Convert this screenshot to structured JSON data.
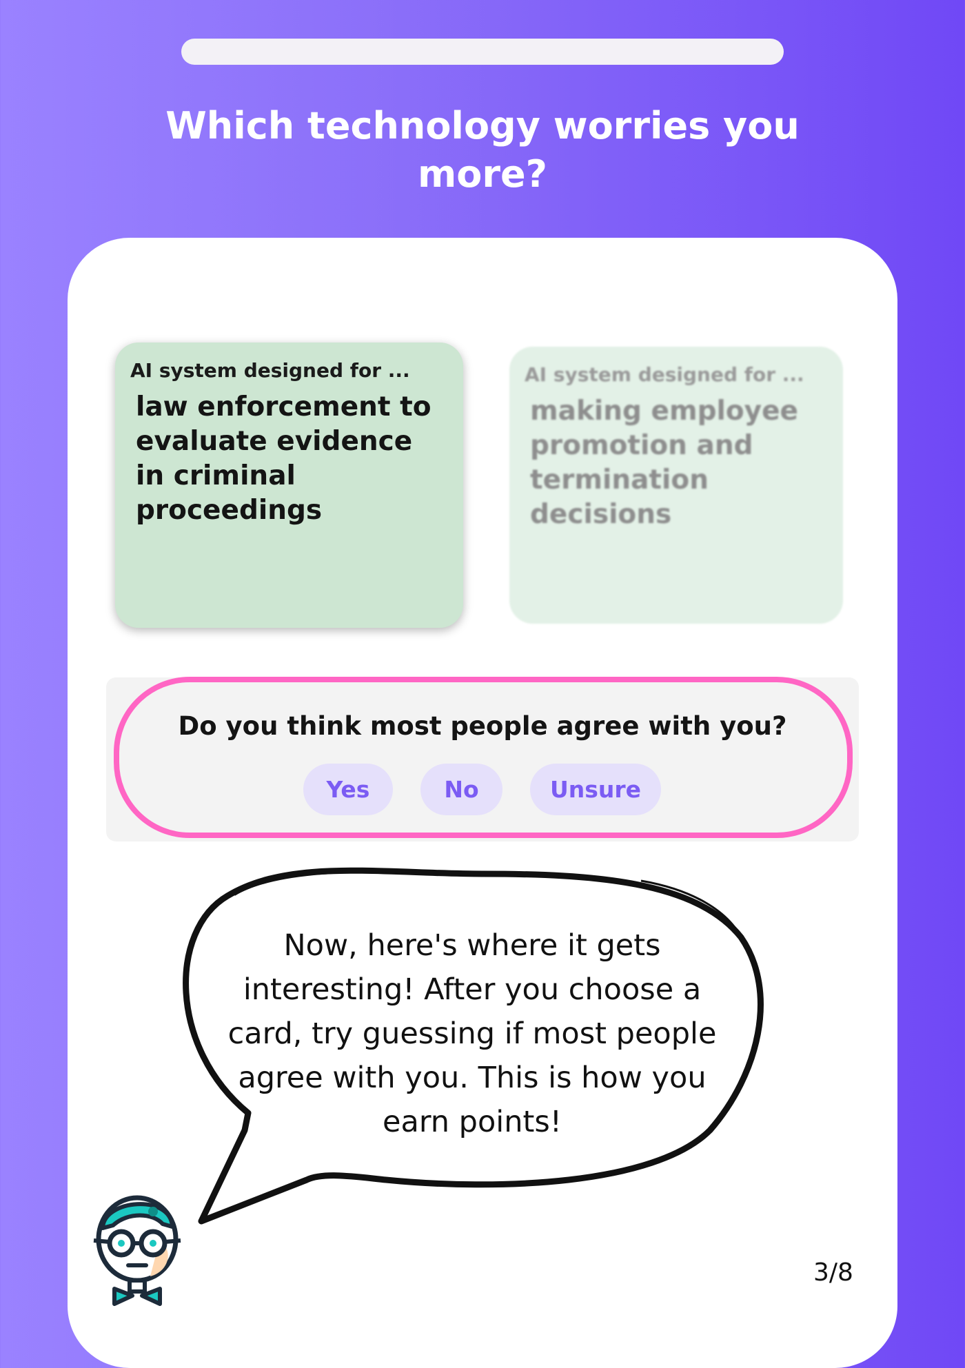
{
  "header": {
    "progress": 0,
    "question": "Which technology worries you more?"
  },
  "options": [
    {
      "prefix": "AI system designed for ...",
      "text": "law enforcement to evaluate evidence in criminal proceedings",
      "state": "selected"
    },
    {
      "prefix": "AI system designed for ...",
      "text": "making employee promotion and termination decisions",
      "state": "dimmed"
    }
  ],
  "agreement": {
    "question": "Do you think most people agree with you?",
    "answers": [
      "Yes",
      "No",
      "Unsure"
    ]
  },
  "guide": {
    "message": "Now, here's where it gets interesting! After you choose a card, try guessing if most people agree with you. This is how you earn points!",
    "avatar_icon": "robot-professor-icon"
  },
  "footer": {
    "page_counter": "3/8"
  },
  "colors": {
    "background_start": "#9a82ff",
    "background_end": "#7048f6",
    "selected_card": "#cde6d2",
    "dimmed_card": "#e3f1e7",
    "highlight_outline": "#ff66c4",
    "button_fill": "#e5e0fb",
    "button_text": "#7b5cf3",
    "avatar_teal": "#1bc8c1"
  }
}
